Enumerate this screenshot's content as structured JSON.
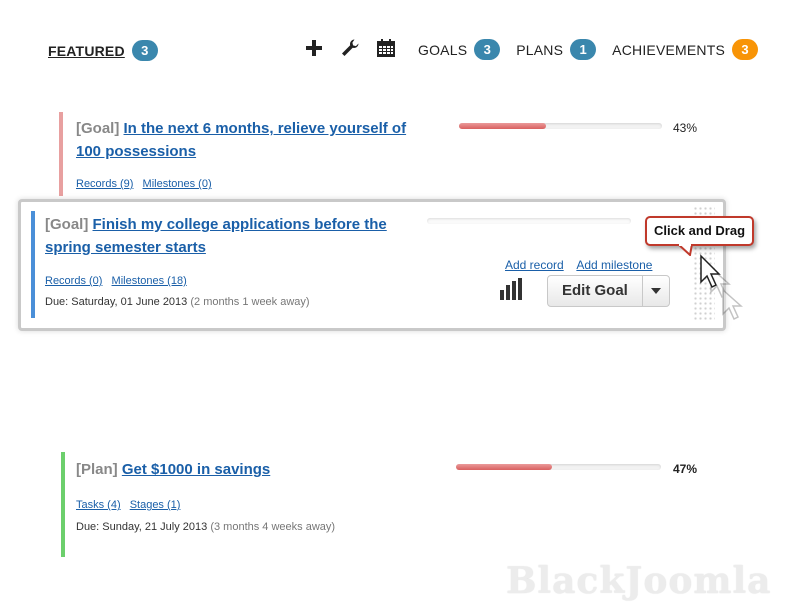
{
  "nav": {
    "featured": {
      "label": "FEATURED",
      "count": "3"
    },
    "tools": [
      {
        "icon": "plus-icon"
      },
      {
        "icon": "wrench-icon"
      },
      {
        "icon": "calendar-icon"
      }
    ],
    "links": [
      {
        "label": "GOALS",
        "count": "3",
        "color": "#3a87ad"
      },
      {
        "label": "PLANS",
        "count": "1",
        "color": "#3a87ad"
      },
      {
        "label": "ACHIEVEMENTS",
        "count": "3",
        "color": "#f89406"
      }
    ]
  },
  "cards": [
    {
      "type": "[Goal]",
      "title": "In the next 6 months, relieve yourself of 100 possessions",
      "links": [
        "Records (9)",
        "Milestones (0)"
      ],
      "progress": 43,
      "progress_label": "43%",
      "bar_color": "#e8a0a0"
    },
    {
      "type": "[Goal]",
      "title": "Finish my college applications before the spring semester starts",
      "links": [
        "Records (0)",
        "Milestones (18)"
      ],
      "due": "Due: Saturday, 01 June 2013",
      "due_relative": "(2 months 1 week away)",
      "progress": 0,
      "actions": {
        "add_record": "Add record",
        "add_milestone": "Add milestone",
        "edit": "Edit Goal"
      },
      "bar_color": "#4a8fd8"
    },
    {
      "type": "[Plan]",
      "title": "Get $1000 in savings",
      "links": [
        "Tasks (4)",
        "Stages (1)"
      ],
      "due": "Due: Sunday, 21 July 2013",
      "due_relative": "(3 months 4 weeks away)",
      "progress": 47,
      "progress_label": "47%",
      "bar_color": "#6ccf6c"
    }
  ],
  "tooltip": "Click and Drag",
  "watermark": "BlackJoomla"
}
